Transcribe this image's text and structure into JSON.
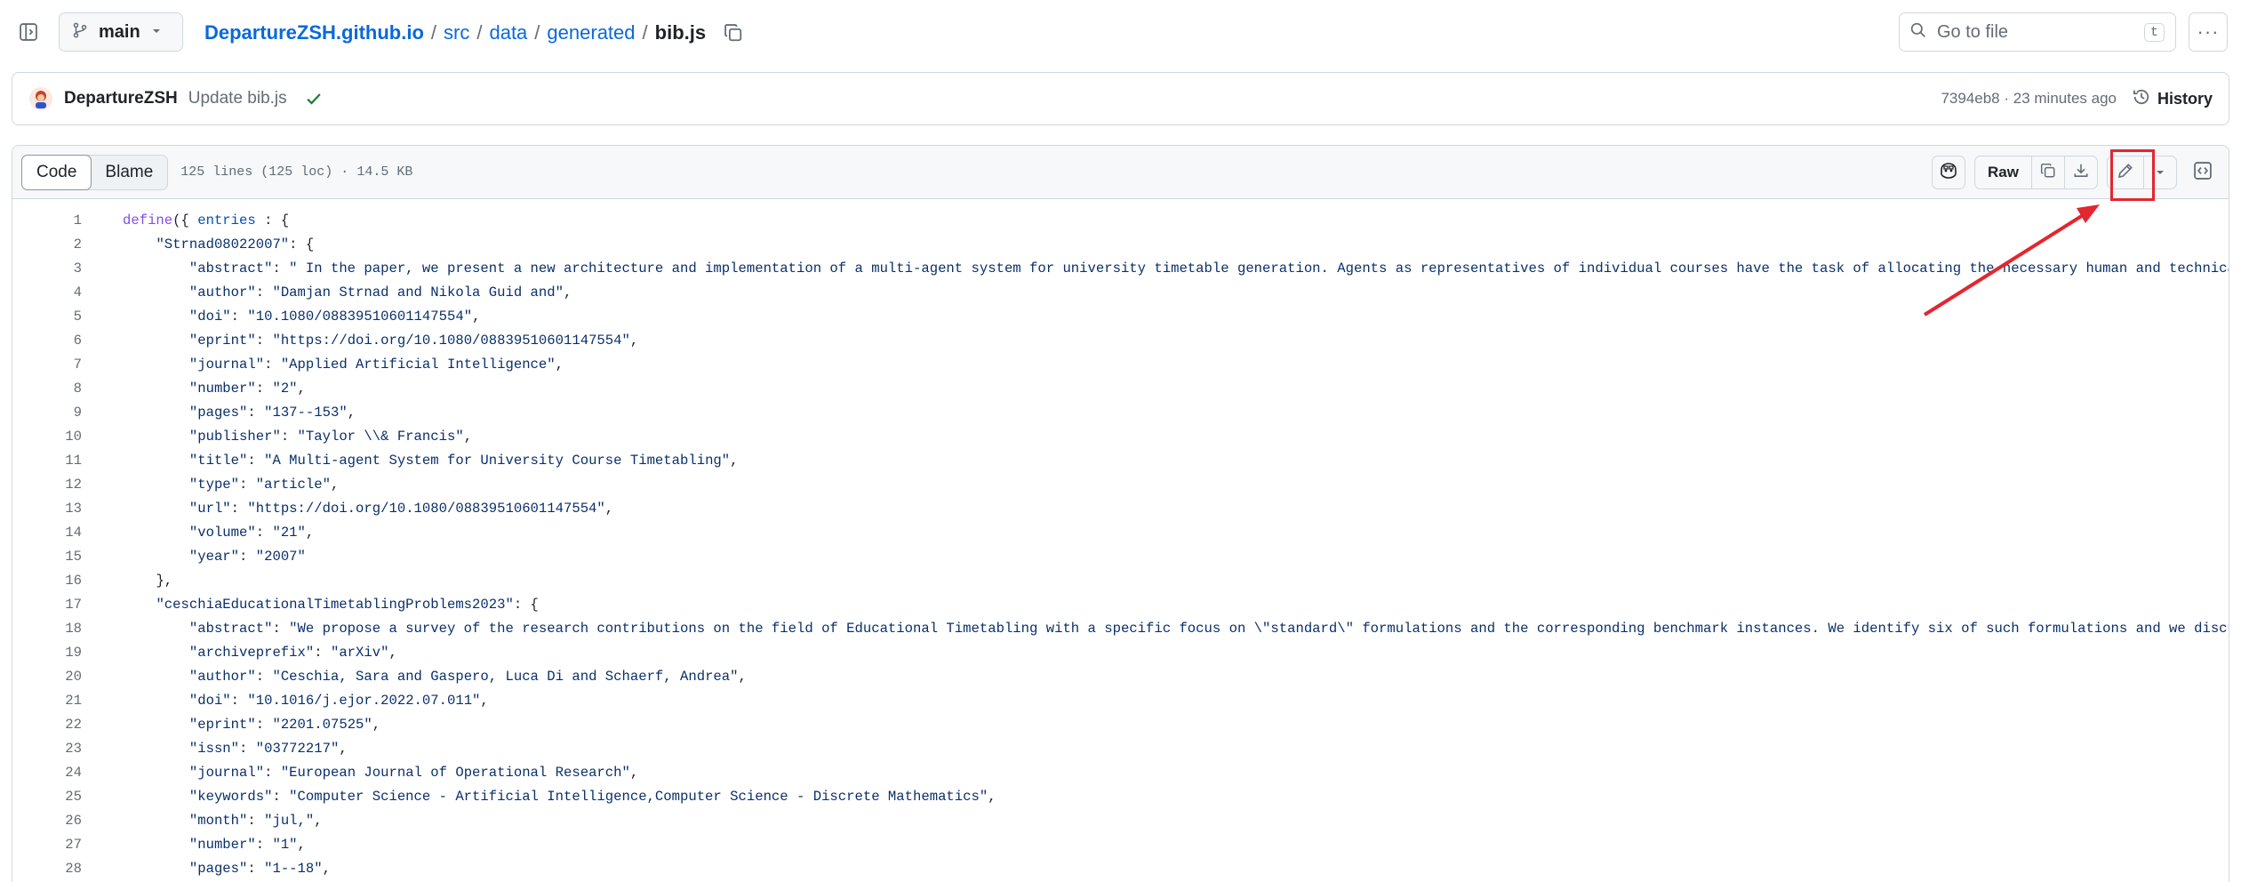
{
  "header": {
    "branch": "main",
    "breadcrumb": {
      "repo": "DepartureZSH.github.io",
      "sep": "/",
      "dirs": [
        "src",
        "data",
        "generated"
      ],
      "file": "bib.js"
    },
    "goto_placeholder": "Go to file",
    "goto_shortcut": "t",
    "more_label": "···"
  },
  "commit": {
    "author": "DepartureZSH",
    "message": "Update bib.js",
    "meta": "7394eb8 · 23 minutes ago",
    "history_label": "History",
    "status_color": "#1a7f37"
  },
  "file": {
    "tabs": [
      "Code",
      "Blame"
    ],
    "active_tab": "Code",
    "info": "125 lines (125 loc) · 14.5 KB",
    "raw_label": "Raw"
  },
  "annotation": {
    "color": "#e3262f"
  },
  "code_lines": [
    {
      "n": "1",
      "indent": "",
      "parts": [
        [
          "kw",
          "define"
        ],
        [
          "pl",
          "({ "
        ],
        [
          "ent",
          "entries"
        ],
        [
          "pl",
          " : {"
        ]
      ]
    },
    {
      "n": "2",
      "indent": "    ",
      "parts": [
        [
          "str",
          "\"Strnad08022007\""
        ],
        [
          "pl",
          ": {"
        ]
      ]
    },
    {
      "n": "3",
      "indent": "        ",
      "parts": [
        [
          "str",
          "\"abstract\""
        ],
        [
          "pl",
          ": "
        ],
        [
          "str",
          "\" In the paper, we present a new architecture and implementation of a multi-agent system for university timetable generation. Agents as representatives of individual courses have the task of allocating the necessary human and technical resources"
        ]
      ]
    },
    {
      "n": "4",
      "indent": "        ",
      "parts": [
        [
          "str",
          "\"author\""
        ],
        [
          "pl",
          ": "
        ],
        [
          "str",
          "\"Damjan Strnad and Nikola Guid and\""
        ],
        [
          "pl",
          ","
        ]
      ]
    },
    {
      "n": "5",
      "indent": "        ",
      "parts": [
        [
          "str",
          "\"doi\""
        ],
        [
          "pl",
          ": "
        ],
        [
          "str",
          "\"10.1080/08839510601147554\""
        ],
        [
          "pl",
          ","
        ]
      ]
    },
    {
      "n": "6",
      "indent": "        ",
      "parts": [
        [
          "str",
          "\"eprint\""
        ],
        [
          "pl",
          ": "
        ],
        [
          "str",
          "\"https://doi.org/10.1080/08839510601147554\""
        ],
        [
          "pl",
          ","
        ]
      ]
    },
    {
      "n": "7",
      "indent": "        ",
      "parts": [
        [
          "str",
          "\"journal\""
        ],
        [
          "pl",
          ": "
        ],
        [
          "str",
          "\"Applied Artificial Intelligence\""
        ],
        [
          "pl",
          ","
        ]
      ]
    },
    {
      "n": "8",
      "indent": "        ",
      "parts": [
        [
          "str",
          "\"number\""
        ],
        [
          "pl",
          ": "
        ],
        [
          "str",
          "\"2\""
        ],
        [
          "pl",
          ","
        ]
      ]
    },
    {
      "n": "9",
      "indent": "        ",
      "parts": [
        [
          "str",
          "\"pages\""
        ],
        [
          "pl",
          ": "
        ],
        [
          "str",
          "\"137--153\""
        ],
        [
          "pl",
          ","
        ]
      ]
    },
    {
      "n": "10",
      "indent": "        ",
      "parts": [
        [
          "str",
          "\"publisher\""
        ],
        [
          "pl",
          ": "
        ],
        [
          "str",
          "\"Taylor \\\\& Francis\""
        ],
        [
          "pl",
          ","
        ]
      ]
    },
    {
      "n": "11",
      "indent": "        ",
      "parts": [
        [
          "str",
          "\"title\""
        ],
        [
          "pl",
          ": "
        ],
        [
          "str",
          "\"A Multi-agent System for University Course Timetabling\""
        ],
        [
          "pl",
          ","
        ]
      ]
    },
    {
      "n": "12",
      "indent": "        ",
      "parts": [
        [
          "str",
          "\"type\""
        ],
        [
          "pl",
          ": "
        ],
        [
          "str",
          "\"article\""
        ],
        [
          "pl",
          ","
        ]
      ]
    },
    {
      "n": "13",
      "indent": "        ",
      "parts": [
        [
          "str",
          "\"url\""
        ],
        [
          "pl",
          ": "
        ],
        [
          "str",
          "\"https://doi.org/10.1080/08839510601147554\""
        ],
        [
          "pl",
          ","
        ]
      ]
    },
    {
      "n": "14",
      "indent": "        ",
      "parts": [
        [
          "str",
          "\"volume\""
        ],
        [
          "pl",
          ": "
        ],
        [
          "str",
          "\"21\""
        ],
        [
          "pl",
          ","
        ]
      ]
    },
    {
      "n": "15",
      "indent": "        ",
      "parts": [
        [
          "str",
          "\"year\""
        ],
        [
          "pl",
          ": "
        ],
        [
          "str",
          "\"2007\""
        ]
      ]
    },
    {
      "n": "16",
      "indent": "    ",
      "parts": [
        [
          "pl",
          "},"
        ]
      ]
    },
    {
      "n": "17",
      "indent": "    ",
      "parts": [
        [
          "str",
          "\"ceschiaEducationalTimetablingProblems2023\""
        ],
        [
          "pl",
          ": {"
        ]
      ]
    },
    {
      "n": "18",
      "indent": "        ",
      "parts": [
        [
          "str",
          "\"abstract\""
        ],
        [
          "pl",
          ": "
        ],
        [
          "str",
          "\"We propose a survey of the research contributions on the field of Educational Timetabling with a specific focus on \\\"standard\\\" formulations and the corresponding benchmark instances. We identify six of such formulations and we discuss their fea"
        ]
      ]
    },
    {
      "n": "19",
      "indent": "        ",
      "parts": [
        [
          "str",
          "\"archiveprefix\""
        ],
        [
          "pl",
          ": "
        ],
        [
          "str",
          "\"arXiv\""
        ],
        [
          "pl",
          ","
        ]
      ]
    },
    {
      "n": "20",
      "indent": "        ",
      "parts": [
        [
          "str",
          "\"author\""
        ],
        [
          "pl",
          ": "
        ],
        [
          "str",
          "\"Ceschia, Sara and Gaspero, Luca Di and Schaerf, Andrea\""
        ],
        [
          "pl",
          ","
        ]
      ]
    },
    {
      "n": "21",
      "indent": "        ",
      "parts": [
        [
          "str",
          "\"doi\""
        ],
        [
          "pl",
          ": "
        ],
        [
          "str",
          "\"10.1016/j.ejor.2022.07.011\""
        ],
        [
          "pl",
          ","
        ]
      ]
    },
    {
      "n": "22",
      "indent": "        ",
      "parts": [
        [
          "str",
          "\"eprint\""
        ],
        [
          "pl",
          ": "
        ],
        [
          "str",
          "\"2201.07525\""
        ],
        [
          "pl",
          ","
        ]
      ]
    },
    {
      "n": "23",
      "indent": "        ",
      "parts": [
        [
          "str",
          "\"issn\""
        ],
        [
          "pl",
          ": "
        ],
        [
          "str",
          "\"03772217\""
        ],
        [
          "pl",
          ","
        ]
      ]
    },
    {
      "n": "24",
      "indent": "        ",
      "parts": [
        [
          "str",
          "\"journal\""
        ],
        [
          "pl",
          ": "
        ],
        [
          "str",
          "\"European Journal of Operational Research\""
        ],
        [
          "pl",
          ","
        ]
      ]
    },
    {
      "n": "25",
      "indent": "        ",
      "parts": [
        [
          "str",
          "\"keywords\""
        ],
        [
          "pl",
          ": "
        ],
        [
          "str",
          "\"Computer Science - Artificial Intelligence,Computer Science - Discrete Mathematics\""
        ],
        [
          "pl",
          ","
        ]
      ]
    },
    {
      "n": "26",
      "indent": "        ",
      "parts": [
        [
          "str",
          "\"month\""
        ],
        [
          "pl",
          ": "
        ],
        [
          "str",
          "\"jul,\""
        ],
        [
          "pl",
          ","
        ]
      ]
    },
    {
      "n": "27",
      "indent": "        ",
      "parts": [
        [
          "str",
          "\"number\""
        ],
        [
          "pl",
          ": "
        ],
        [
          "str",
          "\"1\""
        ],
        [
          "pl",
          ","
        ]
      ]
    },
    {
      "n": "28",
      "indent": "        ",
      "parts": [
        [
          "str",
          "\"pages\""
        ],
        [
          "pl",
          ": "
        ],
        [
          "str",
          "\"1--18\""
        ],
        [
          "pl",
          ","
        ]
      ]
    }
  ]
}
